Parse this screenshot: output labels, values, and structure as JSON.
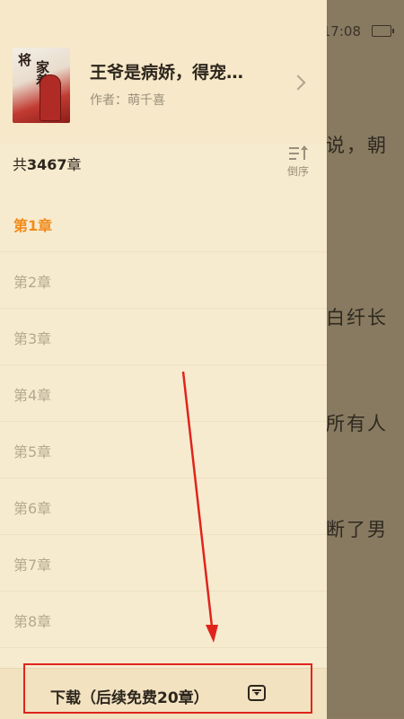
{
  "status_bar": {
    "time": "17:08"
  },
  "reader_background": {
    "lines": [
      "说，朝",
      "白纤长",
      "所有人",
      "断了男"
    ]
  },
  "book": {
    "cover": {
      "title_line1": "将",
      "title_line2": "家着"
    },
    "title": "王爷是病娇，得宠…",
    "author": "作者：萌千喜"
  },
  "chapter_list": {
    "count_prefix": "共",
    "count": "3467",
    "count_suffix": "章",
    "sort_label": "倒序",
    "items": [
      {
        "label": "第1章",
        "active": true
      },
      {
        "label": "第2章",
        "active": false
      },
      {
        "label": "第3章",
        "active": false
      },
      {
        "label": "第4章",
        "active": false
      },
      {
        "label": "第5章",
        "active": false
      },
      {
        "label": "第6章",
        "active": false
      },
      {
        "label": "第7章",
        "active": false
      },
      {
        "label": "第8章",
        "active": false
      }
    ]
  },
  "download": {
    "label": "下载（后续免费20章）"
  },
  "colors": {
    "accent": "#f08c1c",
    "annotation": "#e0241c"
  }
}
